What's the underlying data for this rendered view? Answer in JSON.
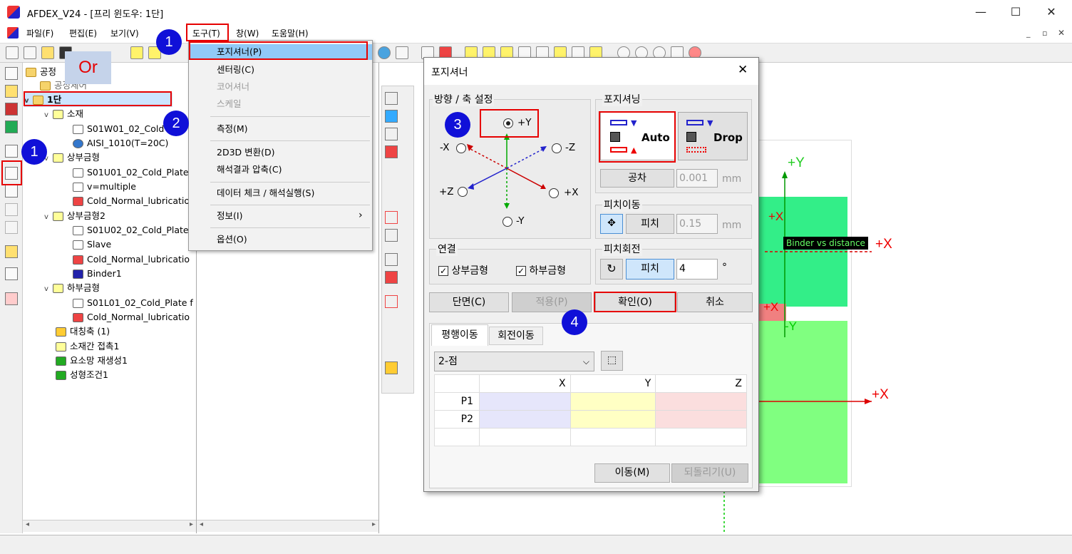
{
  "window": {
    "title": "AFDEX_V24 - [프리 윈도우: 1단]",
    "min": "—",
    "max": "☐",
    "close": "✕"
  },
  "menu": [
    "파일(F)",
    "편집(E)",
    "보기(V)",
    "도구(T)",
    "창(W)",
    "도움말(H)"
  ],
  "annotations": {
    "badge1": "1",
    "badge2": "2",
    "badge3": "3",
    "badge4": "4",
    "or": "Or"
  },
  "tree": {
    "root": "공정",
    "item_hidden": "공정체어",
    "stage": "1단",
    "items": [
      "소재",
      "S01W01_02_Cold",
      "AISI_1010(T=20C)",
      "상부금형",
      "S01U01_02_Cold_Plate",
      "v=multiple",
      "Cold_Normal_lubricatio",
      "상부금형2",
      "S01U02_02_Cold_Plate",
      "Slave",
      "Cold_Normal_lubricatio",
      "Binder1",
      "하부금형",
      "S01L01_02_Cold_Plate f",
      "Cold_Normal_lubricatio",
      "대칭축 (1)",
      "소재간 접촉1",
      "요소망 재생성1",
      "성형조건1"
    ]
  },
  "dropdown": {
    "items": [
      "포지셔너(P)",
      "센터링(C)",
      "코어셔너",
      "스케일",
      "측정(M)",
      "2D3D 변환(D)",
      "해석결과 압축(C)",
      "데이터 체크 / 해석실행(S)",
      "정보(I)",
      "옵션(O)"
    ],
    "submenu_arrow": "›"
  },
  "dialog": {
    "title": "포지셔너",
    "direction_group": "방향 / 축 설정",
    "axes": {
      "py": "+Y",
      "mx": "-X",
      "mz": "-Z",
      "pz": "+Z",
      "px": "+X",
      "my": "-Y"
    },
    "positioning_group": "포지셔닝",
    "auto_label": "Auto",
    "drop_label": "Drop",
    "tolerance_btn": "공차",
    "tolerance_val": "0.001",
    "unit_mm": "mm",
    "pitch_move_group": "피치이동",
    "pitch_btn": "피치",
    "pitch_val": "0.15",
    "pitch_rot_group": "피치회전",
    "pitch_rot_val": "4",
    "deg": "°",
    "connect_group": "연결",
    "cb_upper": "상부금형",
    "cb_lower": "하부금형",
    "btn_section": "단면(C)",
    "btn_apply": "적용(P)",
    "btn_ok": "확인(O)",
    "btn_cancel": "취소",
    "tab_translate": "평행이동",
    "tab_rotate": "회전이동",
    "mode_select": "2-점",
    "table_headers": [
      "X",
      "Y",
      "Z"
    ],
    "rows": [
      "P1",
      "P2"
    ],
    "btn_move": "이동(M)",
    "btn_undo": "되돌리기(U)"
  },
  "canvas": {
    "plus_y": "+Y",
    "plus_x_1": "+X",
    "plus_x_2": "+X",
    "plus_x_3": "+X",
    "minus_y": "-Y",
    "plus_x_bottom": "+X",
    "tooltip": "Binder vs distance"
  },
  "colors": {
    "accent_red": "#e60000",
    "badge_blue": "#1010d8",
    "green_light": "#80ff80",
    "green_mid": "#33ee88",
    "pink": "#f08080"
  }
}
